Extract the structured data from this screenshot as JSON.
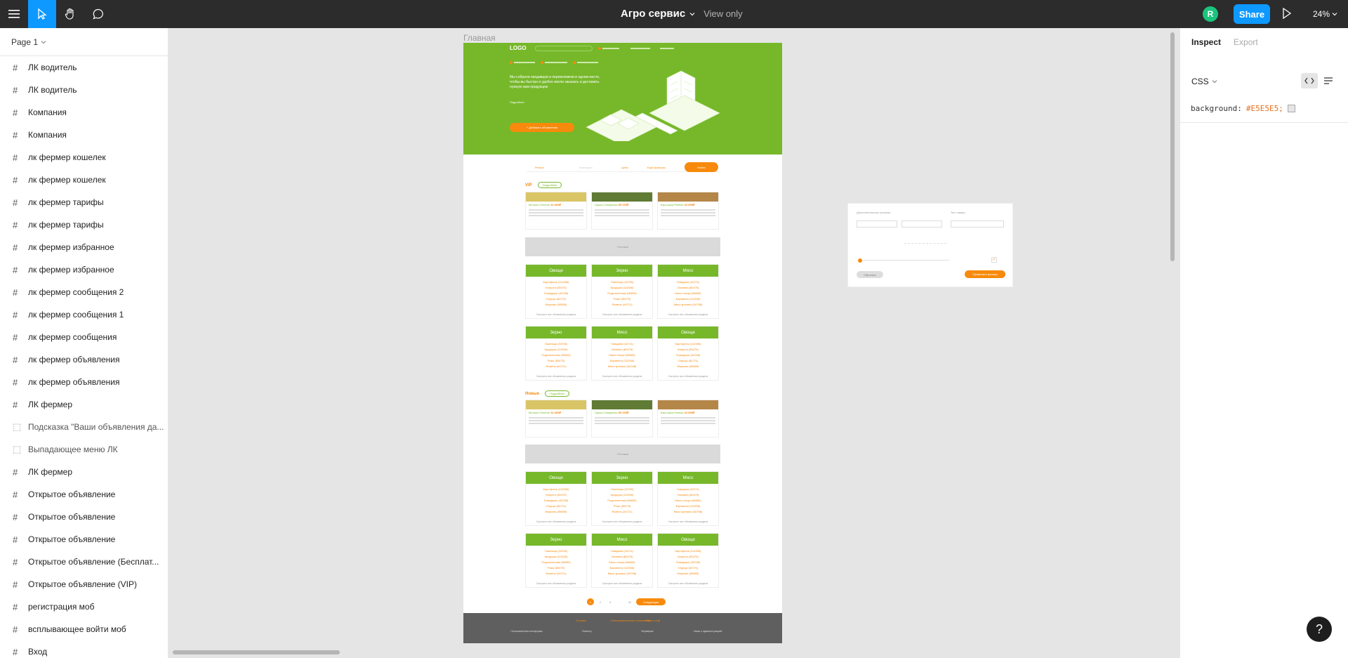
{
  "toolbar": {
    "file_name": "Агро сервис",
    "mode": "View only",
    "avatar_initial": "R",
    "share_label": "Share",
    "zoom": "24%"
  },
  "left_panel": {
    "page_selector": "Page 1",
    "layers": [
      {
        "name": "ЛК водитель",
        "type": "frame"
      },
      {
        "name": "ЛК водитель",
        "type": "frame"
      },
      {
        "name": "Компания",
        "type": "frame"
      },
      {
        "name": "Компания",
        "type": "frame"
      },
      {
        "name": "лк фермер кошелек",
        "type": "frame"
      },
      {
        "name": "лк фермер кошелек",
        "type": "frame"
      },
      {
        "name": "лк фермер тарифы",
        "type": "frame"
      },
      {
        "name": "лк фермер тарифы",
        "type": "frame"
      },
      {
        "name": "лк фермер избранное",
        "type": "frame"
      },
      {
        "name": "лк фермер избранное",
        "type": "frame"
      },
      {
        "name": "лк фермер сообщения 2",
        "type": "frame"
      },
      {
        "name": "лк фермер сообщения 1",
        "type": "frame"
      },
      {
        "name": "лк фермер сообщения",
        "type": "frame"
      },
      {
        "name": "лк фермер объявления",
        "type": "frame"
      },
      {
        "name": "лк фермер объявления",
        "type": "frame"
      },
      {
        "name": "ЛК фермер",
        "type": "frame"
      },
      {
        "name": "Подсказка \"Ваши объявления да...",
        "type": "section"
      },
      {
        "name": "Выпадающее меню ЛК",
        "type": "section"
      },
      {
        "name": "ЛК фермер",
        "type": "frame"
      },
      {
        "name": "Открытое объявление",
        "type": "frame"
      },
      {
        "name": "Открытое объявление",
        "type": "frame"
      },
      {
        "name": "Открытое объявление",
        "type": "frame"
      },
      {
        "name": "Открытое объявление (Бесплат...",
        "type": "frame"
      },
      {
        "name": "Открытое объявление (VIP)",
        "type": "frame"
      },
      {
        "name": "регистрация моб",
        "type": "frame"
      },
      {
        "name": "всплывающее войти моб",
        "type": "frame"
      },
      {
        "name": "Вход",
        "type": "frame"
      }
    ]
  },
  "right_panel": {
    "tabs": [
      "Inspect",
      "Export"
    ],
    "active_tab": "Inspect",
    "code_lang": "CSS",
    "property": "background:",
    "value": "#E5E5E5;",
    "swatch_color": "#E5E5E5"
  },
  "canvas": {
    "frame_label": "Главная",
    "background": "#E5E5E5"
  },
  "design": {
    "logo": "LOGO",
    "accent_green": "#76B82A",
    "accent_orange": "#F78A0C",
    "hero_text": "Мы собрали продавцов и перевозчиков в одном месте, чтобы вы быстро и удобно могли заказать и доставить нужную вам продукцию",
    "hero_link": "Подробнее",
    "hero_button": "+ Добавить объявление",
    "filter_search": "Найти",
    "vip_label": "VIP",
    "new_label": "Новые",
    "ad_label": "Реклама",
    "offers": [
      {
        "title": "Молоко степное",
        "price": "34 859₽"
      },
      {
        "title": "Груша Северянка",
        "price": "95 000₽"
      },
      {
        "title": "Картошка Ранняя",
        "price": "33 859₽"
      }
    ],
    "categories_grid_1": [
      {
        "name": "Овощи",
        "rows": [
          "Картофель (111506)",
          "Капуста (80475)",
          "Помидоры (34788)",
          "Огурцы (64721)",
          "Морковь (98659)"
        ],
        "more": "Смотреть все объявления раздела"
      },
      {
        "name": "Зерно",
        "rows": [
          "Пшеница (34708)",
          "Кукуруза (111506)",
          "Подсолнечник (98659)",
          "Рожь (80475)",
          "Ячмень (44721)"
        ],
        "more": "Смотреть все объявления раздела"
      },
      {
        "name": "Мясо",
        "rows": [
          "Говядина (44721)",
          "Свинина (80475)",
          "Мясо птицы (98659)",
          "Баранина (111506)",
          "Мясо кролика (34788)"
        ],
        "more": "Смотреть все объявления раздела"
      },
      {
        "name": "Зерно",
        "rows": [
          "Пшеница (34708)",
          "Кукуруза (111506)",
          "Подсолнечник (98659)",
          "Рожь (80475)",
          "Ячмень (44721)"
        ],
        "more": "Смотреть все объявления раздела"
      },
      {
        "name": "Мясо",
        "rows": [
          "Говядина (44721)",
          "Свинина (80475)",
          "Мясо птицы (98659)",
          "Баранина (111506)",
          "Мясо кролика (34788)"
        ],
        "more": "Смотреть все объявления раздела"
      },
      {
        "name": "Овощи",
        "rows": [
          "Картофель (111506)",
          "Капуста (80475)",
          "Помидоры (34788)",
          "Огурцы (64721)",
          "Морковь (98659)"
        ],
        "more": "Смотреть все объявления раздела"
      }
    ],
    "categories_grid_2": [
      {
        "name": "Овощи",
        "rows": [
          "Картофель (111506)",
          "Капуста (80475)",
          "Помидоры (34788)",
          "Огурцы (64721)",
          "Морковь (98659)"
        ],
        "more": "Смотреть все объявления раздела"
      },
      {
        "name": "Зерно",
        "rows": [
          "Пшеница (34708)",
          "Кукуруза (111506)",
          "Подсолнечник (98659)",
          "Рожь (80475)",
          "Ячмень (44721)"
        ],
        "more": "Смотреть все объявления раздела"
      },
      {
        "name": "Мясо",
        "rows": [
          "Говядина (44721)",
          "Свинина (80475)",
          "Мясо птицы (98659)",
          "Баранина (111506)",
          "Мясо кролика (34788)"
        ],
        "more": "Смотреть все объявления раздела"
      },
      {
        "name": "Зерно",
        "rows": [
          "Пшеница (34708)",
          "Кукуруза (111506)",
          "Подсолнечник (98659)",
          "Рожь (80475)",
          "Ячмень (44721)"
        ],
        "more": "Смотреть все объявления раздела"
      },
      {
        "name": "Мясо",
        "rows": [
          "Говядина (44721)",
          "Свинина (80475)",
          "Мясо птицы (98659)",
          "Баранина (111506)",
          "Мясо кролика (34788)"
        ],
        "more": "Смотреть все объявления раздела"
      },
      {
        "name": "Овощи",
        "rows": [
          "Картофель (111506)",
          "Капуста (80475)",
          "Помидоры (34788)",
          "Огурцы (64721)",
          "Морковь (98659)"
        ],
        "more": "Смотреть все объявления раздела"
      }
    ],
    "pager": [
      "1",
      "2",
      "3",
      "..",
      "20"
    ],
    "pager_next": "Следующая",
    "footer_links": [
      "Отзывы",
      "Пользовательское соглашение",
      "Наш e-mail"
    ],
    "footer_cols": [
      "Пользователям платформы",
      "Бизнесу",
      "Фермерам",
      "Связь с администрацией"
    ]
  },
  "popup": {
    "title": "Дополнительные условия",
    "field2_label": "Тип товара",
    "apply_label": "Применить фильтр",
    "reset_label": "Сбросить"
  }
}
